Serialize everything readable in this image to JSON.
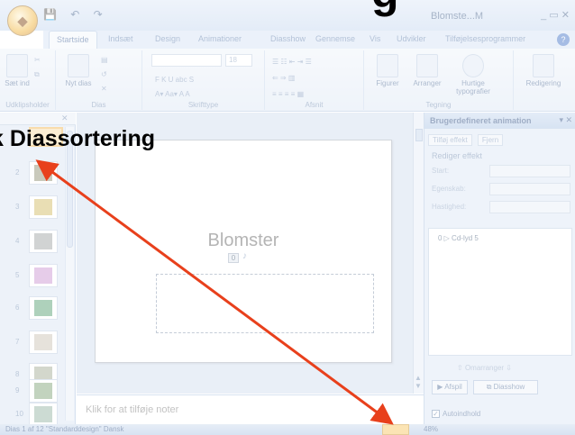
{
  "overlay": {
    "heading_big": "g",
    "heading_label": "k Diassortering",
    "arrow_color": "#e8401c"
  },
  "titlebar": {
    "title": "Blomste...M",
    "qat": "💾 ↶ ↷",
    "buttons": "_ ▭ ✕"
  },
  "ribbon": {
    "tabs": [
      "Startside",
      "Indsæt",
      "Design",
      "Animationer",
      "Diasshow",
      "Gennemse",
      "Vis",
      "Udvikler",
      "Tilføjelsesprogrammer"
    ],
    "groups": {
      "clipboard": "Udklipsholder",
      "slides": "Dias",
      "font": "Skrifttype",
      "paragraph": "Afsnit",
      "drawing": "Tegning",
      "editing": "Redigering"
    },
    "buttons": {
      "paste": "Sæt ind",
      "new_slide": "Nyt dias",
      "shapes": "Figurer",
      "arrange": "Arranger",
      "quick_styles": "Hurtige typografier",
      "editing": "Redigering"
    },
    "font_value": "",
    "size_value": "18"
  },
  "slides_panel": {
    "count": 10,
    "numbers": [
      "2",
      "3",
      "4",
      "5",
      "6",
      "7",
      "8",
      "9",
      "10"
    ]
  },
  "slide": {
    "title": "Blomster",
    "anim_tag": "0"
  },
  "notes": {
    "placeholder": "Klik for at tilføje noter"
  },
  "task_pane": {
    "title": "Brugerdefineret animation",
    "add_effect": "Tilføj effekt",
    "remove": "Fjern",
    "section": "Rediger effekt",
    "fields": [
      "Start:",
      "Egenskab:",
      "Hastighed:"
    ],
    "list_item": "0  ▷ Cd-lyd 5",
    "reorder": "Omarranger",
    "play": "Afspil",
    "slideshow": "Diasshow",
    "autopreview": "Autoindhold"
  },
  "status": {
    "text": "Dias 1 af 12   \"Standarddesign\"   Dansk",
    "zoom": "48%"
  }
}
